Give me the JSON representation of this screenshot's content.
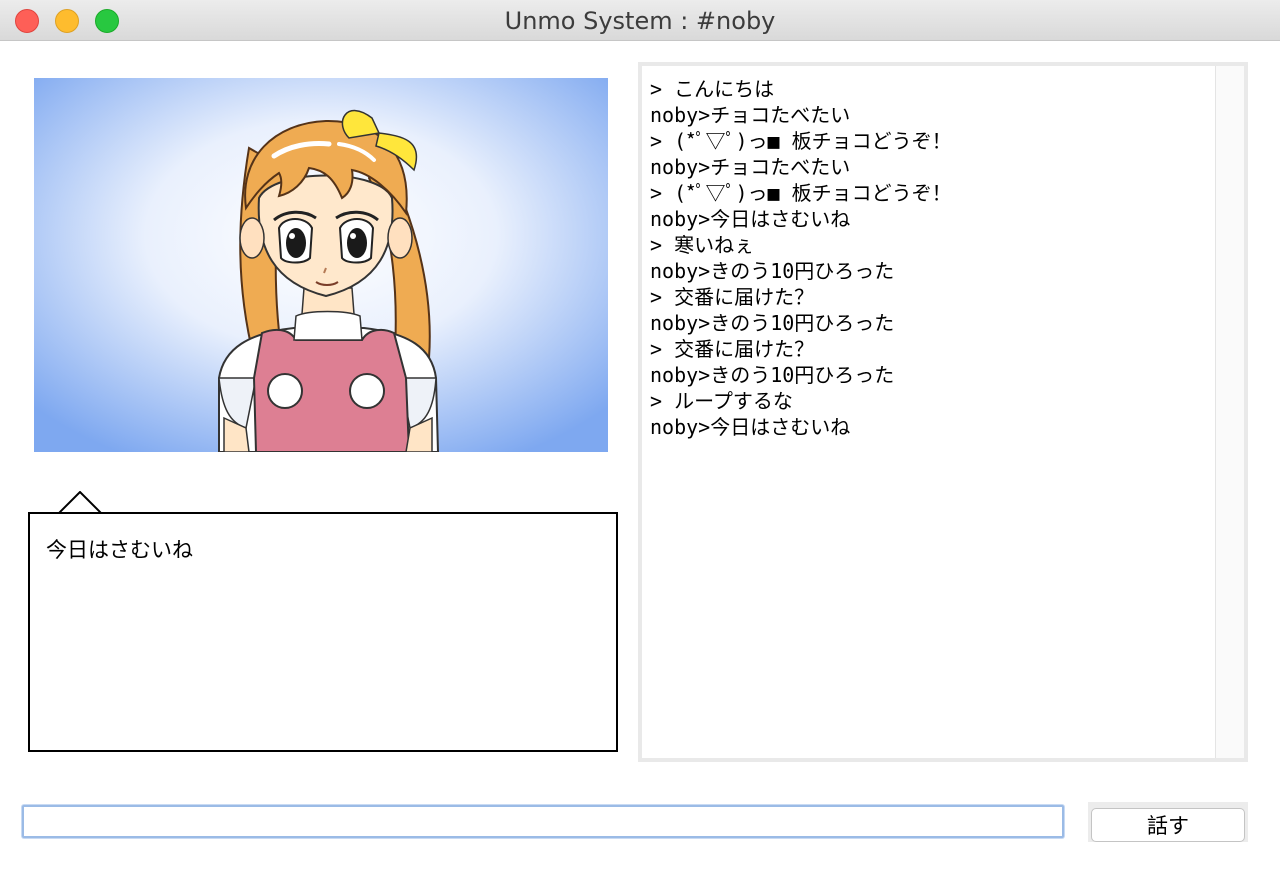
{
  "window": {
    "title": "Unmo System : #noby"
  },
  "balloon": {
    "text": "今日はさむいね"
  },
  "log": {
    "lines": [
      "> こんにちは",
      "noby>チョコたべたい",
      "> (*ﾟ▽ﾟ)っ■ 板チョコどうぞ！",
      "noby>チョコたべたい",
      "> (*ﾟ▽ﾟ)っ■ 板チョコどうぞ！",
      "noby>今日はさむいね",
      "> 寒いねぇ",
      "noby>きのう10円ひろった",
      "> 交番に届けた？",
      "noby>きのう10円ひろった",
      "> 交番に届けた？",
      "noby>きのう10円ひろった",
      "> ループするな",
      "noby>今日はさむいね"
    ]
  },
  "input": {
    "value": "",
    "placeholder": ""
  },
  "talk_button": {
    "label": "話す"
  },
  "icons": {
    "character_image": "anime-girl-portrait"
  }
}
